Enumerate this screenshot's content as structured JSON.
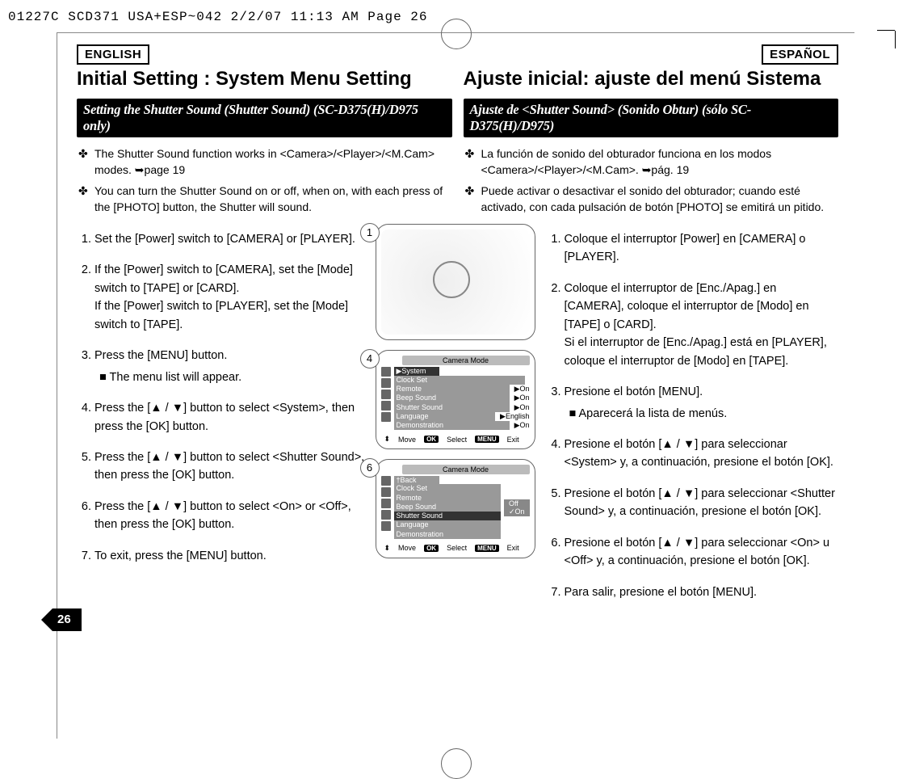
{
  "slug": "01227C SCD371 USA+ESP~042  2/2/07 11:13 AM  Page 26",
  "page_number": "26",
  "en": {
    "lang_tag": "ENGLISH",
    "title": "Initial Setting : System Menu Setting",
    "bar": "Setting the Shutter Sound (Shutter Sound) (SC-D375(H)/D975 only)",
    "bul1": "The Shutter Sound function works in <Camera>/<Player>/<M.Cam> modes. ➥page 19",
    "bul2": "You can turn the Shutter Sound on or off, when on, with each press of the [PHOTO] button, the Shutter will sound.",
    "s1": "Set the [Power] switch to [CAMERA] or [PLAYER].",
    "s2": "If the [Power] switch to [CAMERA], set the [Mode] switch to [TAPE] or [CARD].\nIf the [Power] switch to [PLAYER], set the [Mode] switch to [TAPE].",
    "s3": "Press the [MENU] button.",
    "s3sub": "The menu list will appear.",
    "s4": "Press the [▲ / ▼] button to select <System>, then press the [OK] button.",
    "s5": "Press the [▲ / ▼] button to select <Shutter Sound>, then press the [OK] button.",
    "s6": "Press the [▲ / ▼] button to select <On> or <Off>, then press the [OK] button.",
    "s7": "To exit, press the [MENU] button."
  },
  "es": {
    "lang_tag": "ESPAÑOL",
    "title": "Ajuste inicial: ajuste del menú Sistema",
    "bar": "Ajuste de <Shutter Sound> (Sonido Obtur) (sólo SC-D375(H)/D975)",
    "bul1": "La función de sonido del obturador funciona en los modos <Camera>/<Player>/<M.Cam>. ➥pág. 19",
    "bul2": "Puede activar o desactivar el sonido del obturador; cuando esté activado, con cada pulsación de botón [PHOTO] se emitirá un pitido.",
    "s1": "Coloque el interruptor [Power] en [CAMERA] o [PLAYER].",
    "s2": "Coloque el interruptor de [Enc./Apag.] en [CAMERA], coloque el interruptor de [Modo] en [TAPE] o [CARD].\nSi el interruptor de [Enc./Apag.] está en [PLAYER], coloque el interruptor de [Modo] en [TAPE].",
    "s3": "Presione el botón [MENU].",
    "s3sub": "Aparecerá la lista de menús.",
    "s4": "Presione el botón [▲ / ▼]  para seleccionar <System> y, a continuación, presione el botón [OK].",
    "s5": "Presione el botón [▲ / ▼]  para seleccionar <Shutter Sound> y, a continuación, presione el botón [OK].",
    "s6": "Presione el botón [▲ / ▼] para seleccionar <On> u <Off> y, a continuación, presione el botón [OK].",
    "s7": "Para salir, presione el botón [MENU]."
  },
  "fig1_num": "1",
  "fig4_num": "4",
  "fig6_num": "6",
  "menu4": {
    "mode": "Camera Mode",
    "tab": "▶System",
    "rows": [
      {
        "label": "Clock Set",
        "val": ""
      },
      {
        "label": "Remote",
        "val": "▶On"
      },
      {
        "label": "Beep Sound",
        "val": "▶On"
      },
      {
        "label": "Shutter Sound",
        "val": "▶On"
      },
      {
        "label": "Language",
        "val": "▶English"
      },
      {
        "label": "Demonstration",
        "val": "▶On"
      }
    ]
  },
  "menu6": {
    "mode": "Camera Mode",
    "back": "†Back",
    "rows": [
      {
        "label": "Clock Set"
      },
      {
        "label": "Remote"
      },
      {
        "label": "Beep Sound"
      },
      {
        "label": "Shutter Sound",
        "hl": true
      },
      {
        "label": "Language"
      },
      {
        "label": "Demonstration"
      }
    ],
    "opts": [
      "Off",
      "✓On"
    ]
  },
  "foot": {
    "move": "Move",
    "ok": "OK",
    "select": "Select",
    "menu": "MENU",
    "exit": "Exit"
  }
}
